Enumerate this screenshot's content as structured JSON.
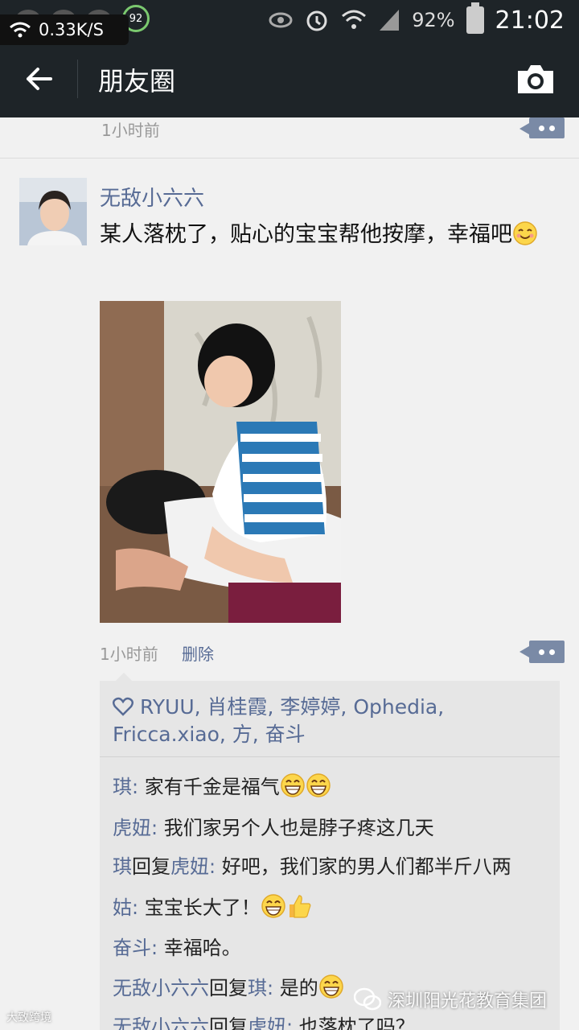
{
  "status_bar": {
    "network_speed": "0.33K/S",
    "badge": "92",
    "battery": "92%",
    "time": "21:02"
  },
  "header": {
    "title": "朋友圈"
  },
  "previous_post": {
    "time": "1小时前"
  },
  "post": {
    "author": "无敌小六六",
    "text": "某人落枕了，贴心的宝宝帮他按摩，幸福吧",
    "time": "1小时前",
    "delete_label": "删除",
    "likes": "RYUU, 肖桂霞, 李婷婷, Ophedia, Fricca.xiao, 方, 奋斗",
    "comments": [
      {
        "name": "琪",
        "sep": ": ",
        "text": "家有千金是福气",
        "emoji": "grin-grin"
      },
      {
        "name": "虎妞",
        "sep": ": ",
        "text": "我们家另个人也是脖子疼这几天",
        "emoji": ""
      },
      {
        "name": "琪",
        "reply_word": "回复",
        "reply_to": "虎妞",
        "sep": ": ",
        "text": "好吧，我们家的男人们都半斤八两",
        "emoji": ""
      },
      {
        "name": "姑",
        "sep": ": ",
        "text": "宝宝长大了！",
        "emoji": "grin-thumb"
      },
      {
        "name": "奋斗",
        "sep": ": ",
        "text": "幸福哈。",
        "emoji": ""
      },
      {
        "name": "无敌小六六",
        "reply_word": "回复",
        "reply_to": "琪",
        "sep": ": ",
        "text": "是的",
        "emoji": "grin"
      },
      {
        "name": "无敌小六六",
        "reply_word": "回复",
        "reply_to": "虎妞",
        "sep": ": ",
        "text": "也落枕了吗？",
        "emoji": ""
      }
    ]
  },
  "watermark": {
    "text": "深圳阳光花教育集团",
    "small": "大致跨境"
  },
  "colors": {
    "bar": "#1e2428",
    "link": "#576b95",
    "comment_button": "#7a8aa6"
  }
}
